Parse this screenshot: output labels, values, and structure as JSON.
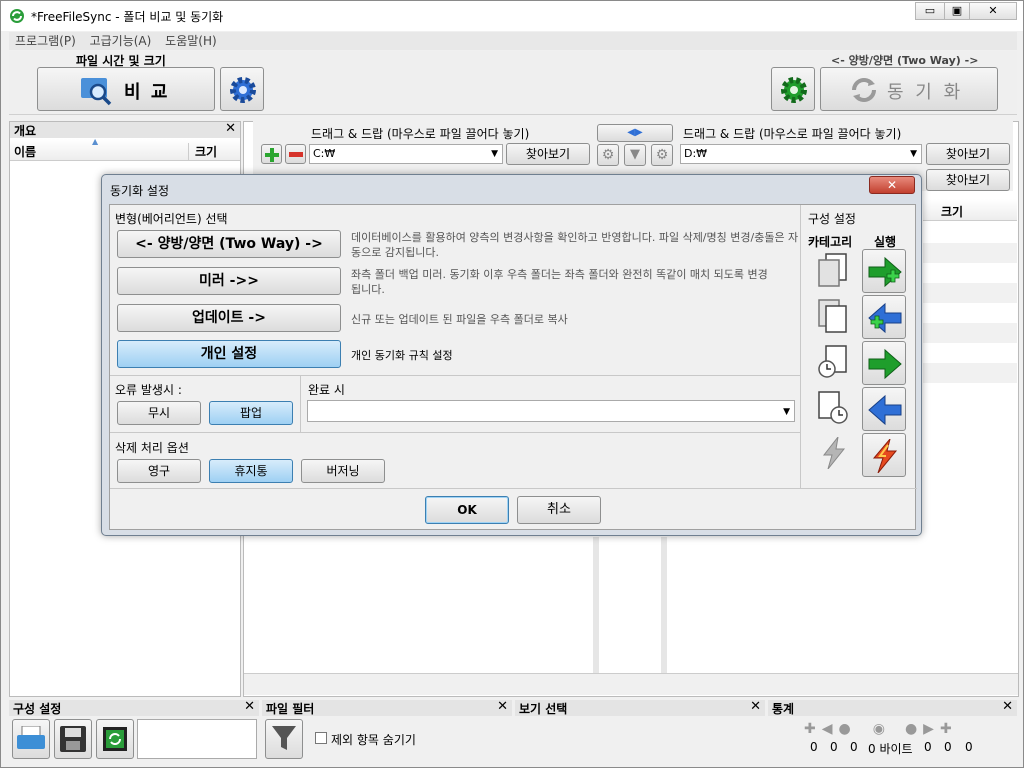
{
  "window": {
    "title": "*FreeFileSync - 폴더 비교 및 동기화",
    "min": "▭",
    "max": "▣",
    "close": "✕"
  },
  "menu": [
    "프로그램(P)",
    "고급기능(A)",
    "도움말(H)"
  ],
  "toolbar": {
    "compare_caption": "파일 시간 및 크기",
    "compare_label": "비 교",
    "sync_caption": "<- 양방/양면 (Two Way) ->",
    "sync_label": "동 기 화"
  },
  "overview": {
    "title": "개요",
    "col_name": "이름",
    "col_size": "크기",
    "sort_arrow": "▲"
  },
  "folders": {
    "left_drag": "드래그 & 드랍 (마우스로 파일 끌어다 놓기)",
    "right_drag": "드래그 & 드랍 (마우스로 파일 끌어다 놓기)",
    "left_path": "C:₩",
    "right_path": "D:₩",
    "browse": "찾아보기",
    "browse2": "찾아보기",
    "right_size_col": "크기",
    "swap": "◀▶"
  },
  "dialog": {
    "title": "동기화 설정",
    "variant_title": "변형(베어리언트) 선택",
    "variants": [
      {
        "label": "<- 양방/양면 (Two Way) ->",
        "desc": "데이터베이스를 활용하여 양측의 변경사항을 확인하고 반영합니다. 파일 삭제/명칭 변경/충돌은 자동으로 감지됩니다."
      },
      {
        "label": "미러 ->>",
        "desc": "좌측 폴더 백업 미러. 동기화 이후 우측 폴더는 좌측 폴더와 완전히 똑같이 매치 되도록 변경 됩니다."
      },
      {
        "label": "업데이트 ->",
        "desc": "신규 또는 업데이트 된 파일을 우측 폴더로 복사"
      },
      {
        "label": "개인 설정",
        "desc": "개인 동기화 규칙 설정"
      }
    ],
    "on_error_title": "오류 발생시 :",
    "on_error_ignore": "무시",
    "on_error_popup": "팝업",
    "on_completion_title": "완료 시",
    "on_completion_value": "",
    "deletion_title": "삭제 처리 옵션",
    "deletion_permanent": "영구",
    "deletion_recycle": "휴지통",
    "deletion_versioning": "버저닝",
    "config_title": "구성 설정",
    "category_header": "카테고리",
    "action_header": "실행",
    "ok": "OK",
    "cancel": "취소",
    "close": "✕"
  },
  "bottom": {
    "config_title": "구성 설정",
    "filter_title": "파일 필터",
    "filter_checkbox": "제외 항목 숨기기",
    "view_title": "보기 선택",
    "stats_title": "통계",
    "stats_values": [
      "0",
      "0",
      "0",
      "0 바이트",
      "0",
      "0",
      "0"
    ]
  },
  "colors": {
    "green": "#1f9e2c",
    "blue": "#2f6fd6",
    "red": "#d4332a",
    "accent": "#3c7fb1"
  }
}
